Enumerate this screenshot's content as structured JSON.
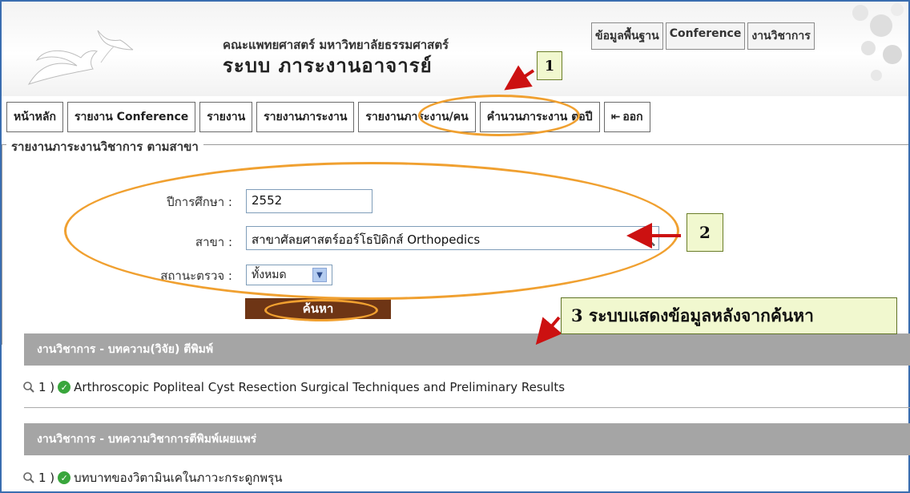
{
  "header": {
    "faculty": "คณะแพทยศาสตร์ มหาวิทยาลัยธรรมศาสตร์",
    "system_name": "ระบบ ภาระงานอาจารย์",
    "top_links": [
      "ข้อมูลพื้นฐาน",
      "Conference",
      "งานวิชาการ"
    ]
  },
  "nav": {
    "items": [
      "หน้าหลัก",
      "รายงาน Conference",
      "รายงาน",
      "รายงานภาระงาน",
      "รายงานภาระงาน/คน",
      "คำนวนภาระงาน ต่อปี",
      "ออก"
    ],
    "active_index": 4
  },
  "section": {
    "title": "รายงานภาระงานวิชาการ ตามสาขา"
  },
  "form": {
    "year_label": "ปีการศึกษา :",
    "year_value": "2552",
    "branch_label": "สาขา :",
    "branch_value": "สาขาศัลยศาสตร์ออร์โธปิดิกส์ Orthopedics",
    "status_label": "สถานะตรวจ :",
    "status_value": "ทั้งหมด",
    "search_button": "ค้นหา"
  },
  "callouts": {
    "one": "1",
    "two": "2",
    "three": "3 ระบบแสดงข้อมูลหลังจากค้นหา"
  },
  "results": [
    {
      "group": "งานวิชาการ - บทความ(วิจัย) ตีพิมพ์",
      "index": "1 )",
      "title": "Arthroscopic Popliteal Cyst Resection Surgical Techniques and Preliminary Results"
    },
    {
      "group": "งานวิชาการ - บทความวิชาการตีพิมพ์เผยแพร่",
      "index": "1 )",
      "title": "บทบาทของวิตามินเคในภาวะกระดูกพรุน"
    }
  ],
  "colors": {
    "accent_orange": "#f0a030",
    "search_button_bg": "#6e3515",
    "result_bar_bg": "#a5a5a5",
    "callout_bg": "#f1f8cf",
    "arrow_red": "#cc1111",
    "ok_green": "#39a63c"
  },
  "icons": {
    "ok": "check-circle-icon",
    "magnifier": "magnifier-icon",
    "logout": "logout-icon"
  }
}
